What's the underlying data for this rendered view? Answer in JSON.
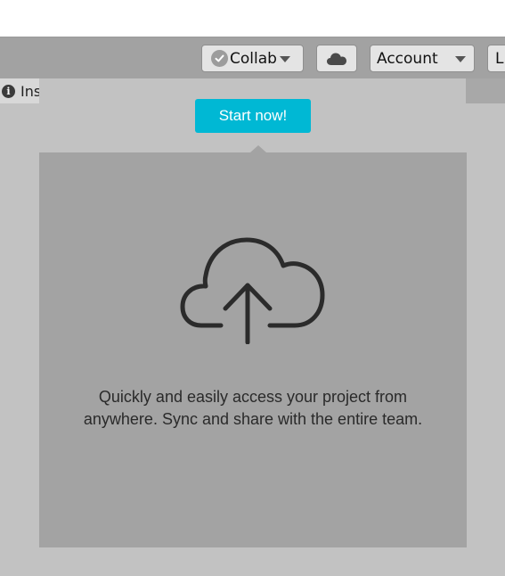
{
  "toolbar": {
    "collab_label": "Collab",
    "account_label": "Account",
    "layers_label": "L"
  },
  "panel": {
    "inspector_tab_label": "Ins"
  },
  "popup": {
    "start_button_label": "Start now!",
    "description_line1": "Quickly and easily access your project from",
    "description_line2": "anywhere. Sync and share with the entire team."
  },
  "icons": {
    "collab_status": "check-circle-icon",
    "cloud_button": "cloud-icon",
    "main_illustration": "cloud-upload-icon",
    "inspector": "info-icon"
  },
  "colors": {
    "accent": "#00b8d4",
    "toolbar_bg": "#a2a2a2",
    "panel_bg": "#c2c2c2",
    "content_bg": "#a3a3a3"
  }
}
